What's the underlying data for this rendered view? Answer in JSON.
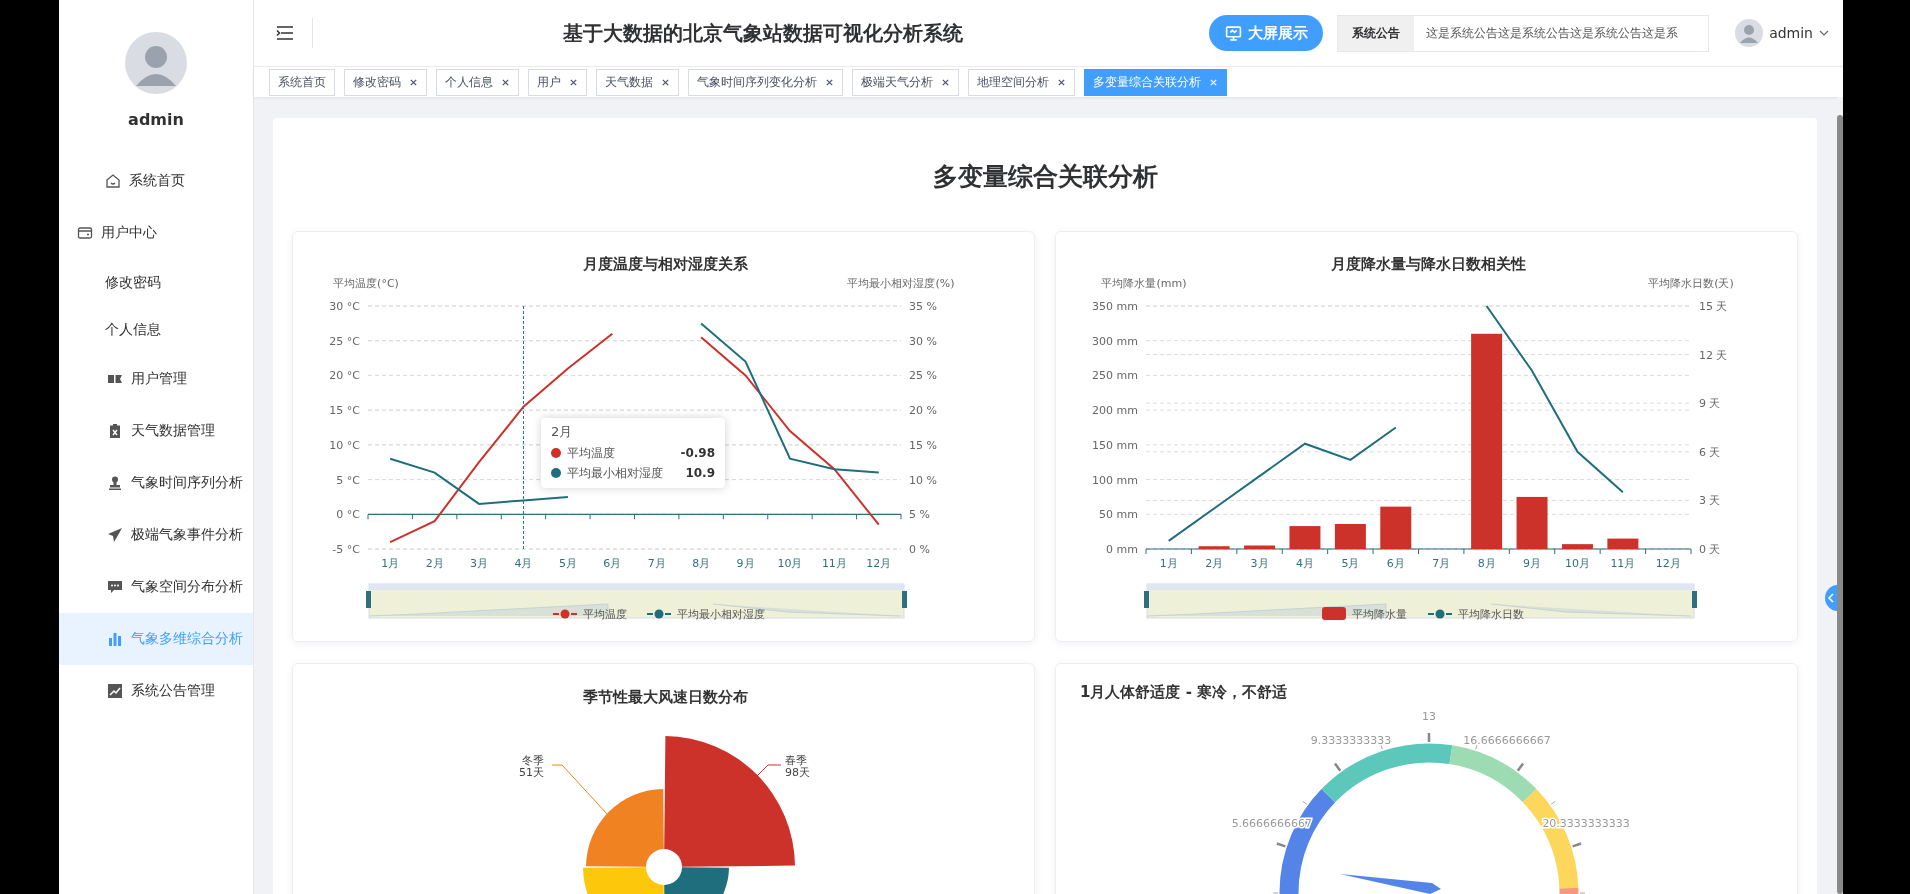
{
  "sidebar": {
    "username": "admin",
    "items": [
      {
        "label": "系统首页",
        "selected": false
      },
      {
        "label": "用户中心",
        "selected": false,
        "children": [
          {
            "label": "修改密码",
            "selected": false
          },
          {
            "label": "个人信息",
            "selected": false
          }
        ]
      },
      {
        "label": "用户管理",
        "selected": false
      },
      {
        "label": "天气数据管理",
        "selected": false
      },
      {
        "label": "气象时间序列分析",
        "selected": false
      },
      {
        "label": "极端气象事件分析",
        "selected": false
      },
      {
        "label": "气象空间分布分析",
        "selected": false
      },
      {
        "label": "气象多维综合分析",
        "selected": true
      },
      {
        "label": "系统公告管理",
        "selected": false
      }
    ]
  },
  "header": {
    "title": "基于大数据的北京气象站数据可视化分析系统",
    "screen_button": "大屏展示",
    "notice_label": "系统公告",
    "notice_text": "这是系统公告这是系统公告这是系统公告这是系",
    "user": "admin"
  },
  "tabs": [
    {
      "label": "系统首页",
      "selected": false,
      "closable": false
    },
    {
      "label": "修改密码",
      "selected": false,
      "closable": true
    },
    {
      "label": "个人信息",
      "selected": false,
      "closable": true
    },
    {
      "label": "用户",
      "selected": false,
      "closable": true
    },
    {
      "label": "天气数据",
      "selected": false,
      "closable": true
    },
    {
      "label": "气象时间序列变化分析",
      "selected": false,
      "closable": true
    },
    {
      "label": "极端天气分析",
      "selected": false,
      "closable": true
    },
    {
      "label": "地理空间分析",
      "selected": false,
      "closable": true
    },
    {
      "label": "多变量综合关联分析",
      "selected": true,
      "closable": true
    }
  ],
  "page_title": "多变量综合关联分析",
  "charts": [
    {
      "chart_data": {
        "type": "line",
        "title": "月度温度与相对湿度关系",
        "ylabel": "平均温度(°C)",
        "y2label": "平均最小相对湿度(%)",
        "categories": [
          "1月",
          "2月",
          "3月",
          "4月",
          "5月",
          "6月",
          "7月",
          "8月",
          "9月",
          "10月",
          "11月",
          "12月"
        ],
        "series": [
          {
            "name": "平均温度",
            "color": "#cc3229",
            "values": [
              -4,
              -1,
              7.5,
              15.5,
              21,
              26,
              null,
              25.5,
              20,
              12,
              6.5,
              -1.5
            ]
          },
          {
            "name": "平均最小相对湿度",
            "axis": "y2",
            "color": "#1f6e7d",
            "values": [
              13,
              11,
              6.5,
              7,
              7.5,
              null,
              null,
              32.5,
              27,
              13,
              11.5,
              11
            ]
          }
        ],
        "ylim": [
          -5,
          30
        ],
        "y2lim": [
          0,
          35
        ],
        "grid": true,
        "legend": "bottom",
        "ref_lines": [
          {
            "axis": "y",
            "value": 0
          },
          {
            "axis": "x",
            "value": "4月"
          }
        ],
        "yticks": [
          {
            "value": -5,
            "label": "-5 °C"
          },
          {
            "value": 0,
            "label": "0 °C"
          },
          {
            "value": 5,
            "label": "5 °C"
          },
          {
            "value": 10,
            "label": "10 °C"
          },
          {
            "value": 15,
            "label": "15 °C"
          },
          {
            "value": 20,
            "label": "20 °C"
          },
          {
            "value": 25,
            "label": "25 °C"
          },
          {
            "value": 30,
            "label": "30 °C"
          }
        ],
        "y2ticks": [
          {
            "value": 0,
            "label": "0 %"
          },
          {
            "value": 5,
            "label": "5 %"
          },
          {
            "value": 10,
            "label": "10 %"
          },
          {
            "value": 15,
            "label": "15 %"
          },
          {
            "value": 20,
            "label": "20 %"
          },
          {
            "value": 25,
            "label": "25 %"
          },
          {
            "value": 30,
            "label": "30 %"
          },
          {
            "value": 35,
            "label": "35 %"
          }
        ]
      },
      "tooltip": {
        "title": "2月",
        "rows": [
          {
            "name": "平均温度",
            "value": "-0.98",
            "color": "#cc3229"
          },
          {
            "name": "平均最小相对湿度",
            "value": "10.9",
            "color": "#1f6e7d"
          }
        ]
      }
    },
    {
      "chart_data": {
        "type": "bar",
        "title": "月度降水量与降水日数相关性",
        "ylabel": "平均降水量(mm)",
        "y2label": "平均降水日数(天)",
        "categories": [
          "1月",
          "2月",
          "3月",
          "4月",
          "5月",
          "6月",
          "7月",
          "8月",
          "9月",
          "10月",
          "11月",
          "12月"
        ],
        "series": [
          {
            "name": "平均降水量",
            "color": "#cc3229",
            "values": [
              0,
              4,
              5,
              33,
              36,
              61,
              null,
              310,
              75,
              7,
              15,
              null
            ]
          },
          {
            "name": "平均降水日数",
            "type": "line",
            "axis": "y2",
            "color": "#1f6e7d",
            "values": [
              0.5,
              2.5,
              4.5,
              6.5,
              5.5,
              7.5,
              null,
              15,
              11,
              6,
              3.5,
              null
            ]
          }
        ],
        "ylim": [
          0,
          350
        ],
        "y2lim": [
          0,
          15
        ],
        "grid": true,
        "legend": "bottom",
        "yticks": [
          {
            "value": 0,
            "label": "0 mm"
          },
          {
            "value": 50,
            "label": "50 mm"
          },
          {
            "value": 100,
            "label": "100 mm"
          },
          {
            "value": 150,
            "label": "150 mm"
          },
          {
            "value": 200,
            "label": "200 mm"
          },
          {
            "value": 250,
            "label": "250 mm"
          },
          {
            "value": 300,
            "label": "300 mm"
          },
          {
            "value": 350,
            "label": "350 mm"
          }
        ],
        "y2ticks": [
          {
            "value": 0,
            "label": "0 天"
          },
          {
            "value": 3,
            "label": "3 天"
          },
          {
            "value": 6,
            "label": "6 天"
          },
          {
            "value": 9,
            "label": "9 天"
          },
          {
            "value": 12,
            "label": "12 天"
          },
          {
            "value": 15,
            "label": "15 天"
          }
        ]
      }
    }
  ],
  "rose": {
    "title": "季节性最大风速日数分布",
    "labels": [
      {
        "name": "冬季",
        "value": "51天",
        "color": "#f18221"
      },
      {
        "name": "春季",
        "value": "98天",
        "color": "#cc3229"
      }
    ]
  },
  "gauge": {
    "title": "1月人体舒适度 - 寒冷，不舒适",
    "tick_labels": [
      "5.6666666667",
      "9.3333333333",
      "13",
      "16.6666666667",
      "20.3333333333"
    ]
  }
}
